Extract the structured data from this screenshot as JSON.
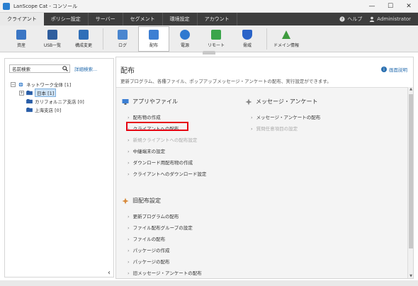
{
  "window": {
    "title": "LanScope Cat - コンソール",
    "minimize": "—",
    "maximize": "☐",
    "close": "✕"
  },
  "menu": {
    "tabs": [
      "クライアント",
      "ポリシー設定",
      "サーバー",
      "セグメント",
      "環境設定",
      "アカウント"
    ],
    "active_index": 0,
    "help_label": "ヘルプ",
    "user_label": "Administrator"
  },
  "toolbar": {
    "tools": [
      {
        "label": "資産",
        "icon": "asset-icon",
        "color": "#3b76c4"
      },
      {
        "label": "USB一覧",
        "icon": "usb-icon",
        "color": "#2f5e9e"
      },
      {
        "label": "構成変更",
        "icon": "config-change-icon",
        "color": "#2f6fb8"
      },
      {
        "label": "ログ",
        "icon": "log-icon",
        "color": "#4a86cf"
      },
      {
        "label": "配布",
        "icon": "distribute-icon",
        "color": "#3d7fd3",
        "active": true
      },
      {
        "label": "電源",
        "icon": "power-icon",
        "color": "#2f79d0"
      },
      {
        "label": "リモート",
        "icon": "remote-icon",
        "color": "#3aa54a"
      },
      {
        "label": "脅威",
        "icon": "threat-icon",
        "color": "#2a63c8"
      },
      {
        "label": "ドメイン情報",
        "icon": "domain-icon",
        "color": "#3e9b3e"
      }
    ]
  },
  "sidebar": {
    "search_placeholder": "名前検索",
    "advanced_search": "詳細検索...",
    "tree": {
      "root": "ネットワーク全体 [1]",
      "children": [
        "日本 [1]",
        "カリフォルニア支店 [0]",
        "上海支店 [0]"
      ]
    }
  },
  "main": {
    "title": "配布",
    "description": "更新プログラム、各種ファイル、ポップアップメッセージ・アンケートの配布、実行設定ができます。",
    "help_link": "画面説明",
    "sections": {
      "apps": {
        "heading": "アプリやファイル",
        "links": [
          {
            "label": "配布物の作成",
            "disabled": false
          },
          {
            "label": "クライアントへの配布",
            "disabled": false
          },
          {
            "label": "新規クライアントへの配布設定",
            "disabled": true
          },
          {
            "label": "中継端末の設定",
            "disabled": false
          },
          {
            "label": "ダウンロード用配布物の作成",
            "disabled": false
          },
          {
            "label": "クライアントへのダウンロード設定",
            "disabled": false
          }
        ]
      },
      "messages": {
        "heading": "メッセージ・アンケート",
        "links": [
          {
            "label": "メッセージ・アンケートの配布",
            "disabled": false
          },
          {
            "label": "質問任意項目の設定",
            "disabled": true
          }
        ]
      },
      "legacy": {
        "heading": "旧配布設定",
        "links": [
          {
            "label": "更新プログラムの配布",
            "disabled": false
          },
          {
            "label": "ファイル配布グループの設定",
            "disabled": false
          },
          {
            "label": "ファイルの配布",
            "disabled": false
          },
          {
            "label": "パッケージの作成",
            "disabled": false
          },
          {
            "label": "パッケージの配布",
            "disabled": false
          },
          {
            "label": "旧メッセージ・アンケートの配布",
            "disabled": false
          }
        ]
      }
    },
    "highlight_color": "#e60012"
  }
}
